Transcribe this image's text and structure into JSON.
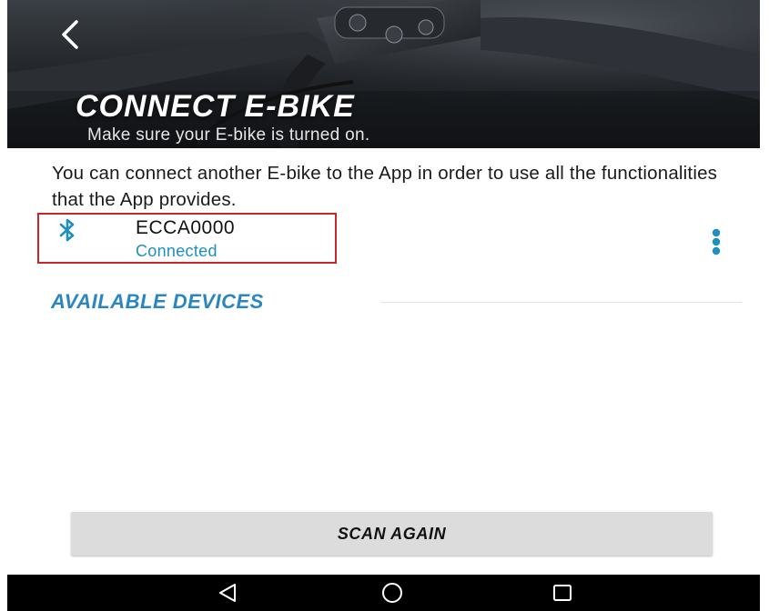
{
  "header": {
    "title": "CONNECT E-BIKE",
    "subtitle": "Make sure your E-bike is turned on."
  },
  "intro_text": "You can connect another E-bike to the App in order to use all the functionalities that the App provides.",
  "connected_device": {
    "icon": "bluetooth-icon",
    "name": "ECCA0000",
    "status": "Connected",
    "status_color": "#1f8fc0",
    "highlight_color": "#c62828"
  },
  "available_devices": {
    "heading": "AVAILABLE DEVICES",
    "heading_color": "#2a86c2",
    "items": []
  },
  "scan_button": {
    "label": "SCAN AGAIN"
  },
  "nav_bar": {
    "back_icon": "triangle-back-icon",
    "home_icon": "circle-home-icon",
    "recents_icon": "square-recents-icon"
  }
}
